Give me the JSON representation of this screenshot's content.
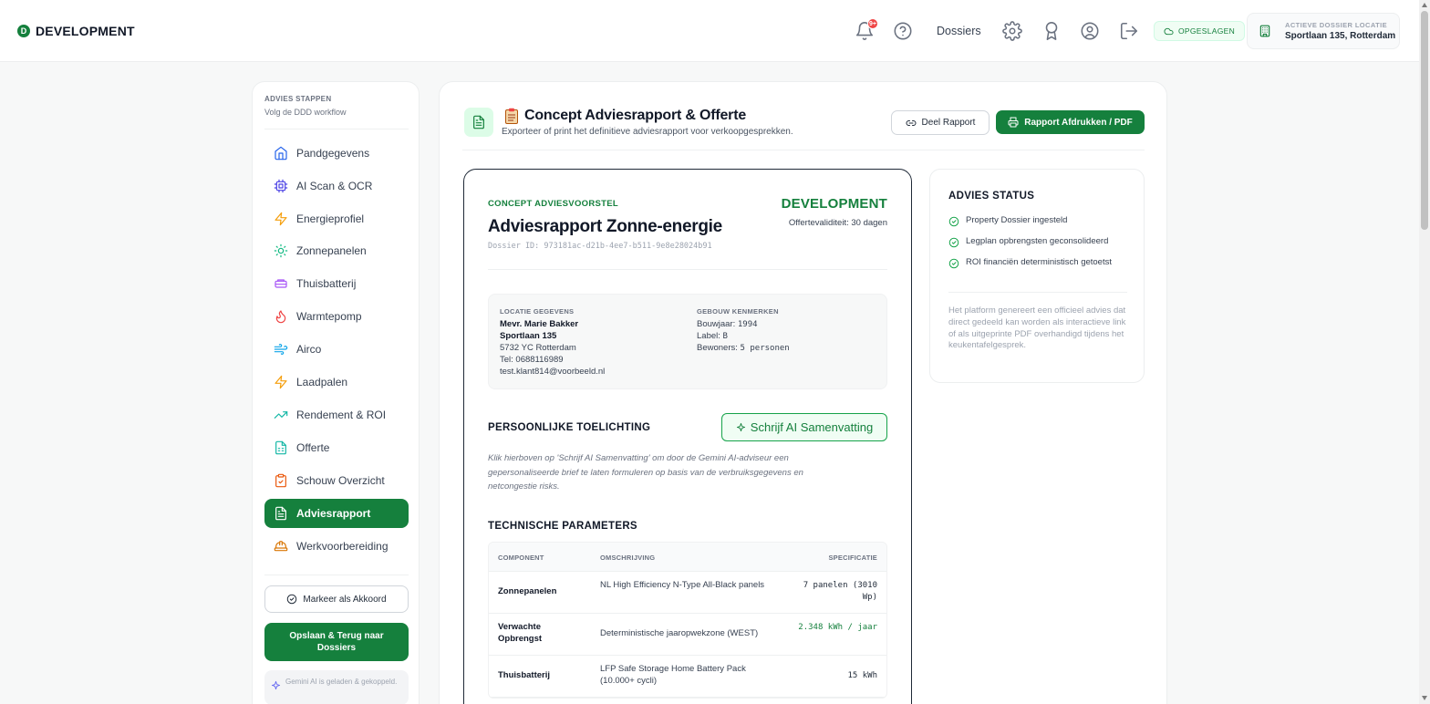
{
  "brand": {
    "mark": "D",
    "name": "DEVELOPMENT"
  },
  "topbar": {
    "notification_count": "9+",
    "dossiers_label": "Dossiers",
    "saved_label": "OPGESLAGEN",
    "location_label": "ACTIEVE DOSSIER LOCATIE",
    "location_value": "Sportlaan 135, Rotterdam"
  },
  "sidebar": {
    "title": "ADVIES STAPPEN",
    "subtitle": "Volg de DDD workflow",
    "items": [
      {
        "label": "Pandgegevens",
        "icon": "home-icon"
      },
      {
        "label": "AI Scan & OCR",
        "icon": "cpu-icon"
      },
      {
        "label": "Energieprofiel",
        "icon": "bolt-icon"
      },
      {
        "label": "Zonnepanelen",
        "icon": "sun-icon"
      },
      {
        "label": "Thuisbatterij",
        "icon": "battery-icon"
      },
      {
        "label": "Warmtepomp",
        "icon": "flame-icon"
      },
      {
        "label": "Airco",
        "icon": "wind-icon"
      },
      {
        "label": "Laadpalen",
        "icon": "bolt-icon"
      },
      {
        "label": "Rendement & ROI",
        "icon": "trend-icon"
      },
      {
        "label": "Offerte",
        "icon": "spreadsheet-icon"
      },
      {
        "label": "Schouw Overzicht",
        "icon": "clipboard-icon"
      },
      {
        "label": "Adviesrapport",
        "icon": "document-icon"
      },
      {
        "label": "Werkvoorbereiding",
        "icon": "helmet-icon"
      }
    ],
    "active_index": 11,
    "approve_label": "Markeer als Akkoord",
    "save_label": "Opslaan & Terug naar Dossiers",
    "gemini_note": "Gemini AI is geladen & gekoppeld."
  },
  "header": {
    "emoji": "📋",
    "title": "Concept Adviesrapport & Offerte",
    "subtitle": "Exporteer of print het definitieve adviesrapport voor verkoopgesprekken.",
    "share_label": "Deel Rapport",
    "print_label": "Rapport Afdrukken / PDF"
  },
  "report": {
    "eyebrow": "CONCEPT ADVIESVOORSTEL",
    "title": "Adviesrapport Zonne-energie",
    "dossier_id": "Dossier ID: 973181ac-d21b-4ee7-b511-9e8e28024b91",
    "brand": "DEVELOPMENT",
    "validity": "Offertevaliditeit: 30 dagen",
    "location": {
      "label": "LOCATIE GEGEVENS",
      "name": "Mevr. Marie Bakker",
      "street": "Sportlaan 135",
      "city": "5732 YC Rotterdam",
      "phone": "Tel: 0688116989",
      "email": "test.klant814@voorbeeld.nl"
    },
    "building": {
      "label": "GEBOUW KENMERKEN",
      "year_label": "Bouwjaar:",
      "year": "1994",
      "energy_label_label": "Label:",
      "energy_label": "B",
      "residents_label": "Bewoners:",
      "residents": "5 personen"
    },
    "personal_title": "PERSOONLIJKE TOELICHTING",
    "ai_button": "Schrijf AI Samenvatting",
    "hint": "Klik hierboven op 'Schrijf AI Samenvatting' om door de Gemini AI-adviseur een gepersonaliseerde brief te laten formuleren op basis van de verbruiksgegevens en netcongestie risks.",
    "tech_title": "TECHNISCHE PARAMETERS",
    "table": {
      "headers": [
        "COMPONENT",
        "OMSCHRIJVING",
        "SPECIFICATIE"
      ],
      "rows": [
        {
          "component": "Zonnepanelen",
          "description": "NL High Efficiency N-Type All-Black panels",
          "spec": "7 panelen (3010 Wp)"
        },
        {
          "component": "Verwachte Opbrengst",
          "description": "Deterministische jaaropwekzone (WEST)",
          "spec": "2.348 kWh / jaar"
        },
        {
          "component": "Thuisbatterij",
          "description": "LFP Safe Storage Home Battery Pack (10.000+ cycli)",
          "spec": "15 kWh"
        }
      ]
    }
  },
  "status": {
    "title": "ADVIES STATUS",
    "items": [
      "Property Dossier ingesteld",
      "Legplan opbrengsten geconsolideerd",
      "ROI financiën deterministisch getoetst"
    ],
    "note": "Het platform genereert een officieel advies dat direct gedeeld kan worden als interactieve link of als uitgeprinte PDF overhandigd tijdens het keukentafelgesprek."
  },
  "colors": {
    "accent": "#15803d",
    "accent_light": "#dcfce7"
  }
}
